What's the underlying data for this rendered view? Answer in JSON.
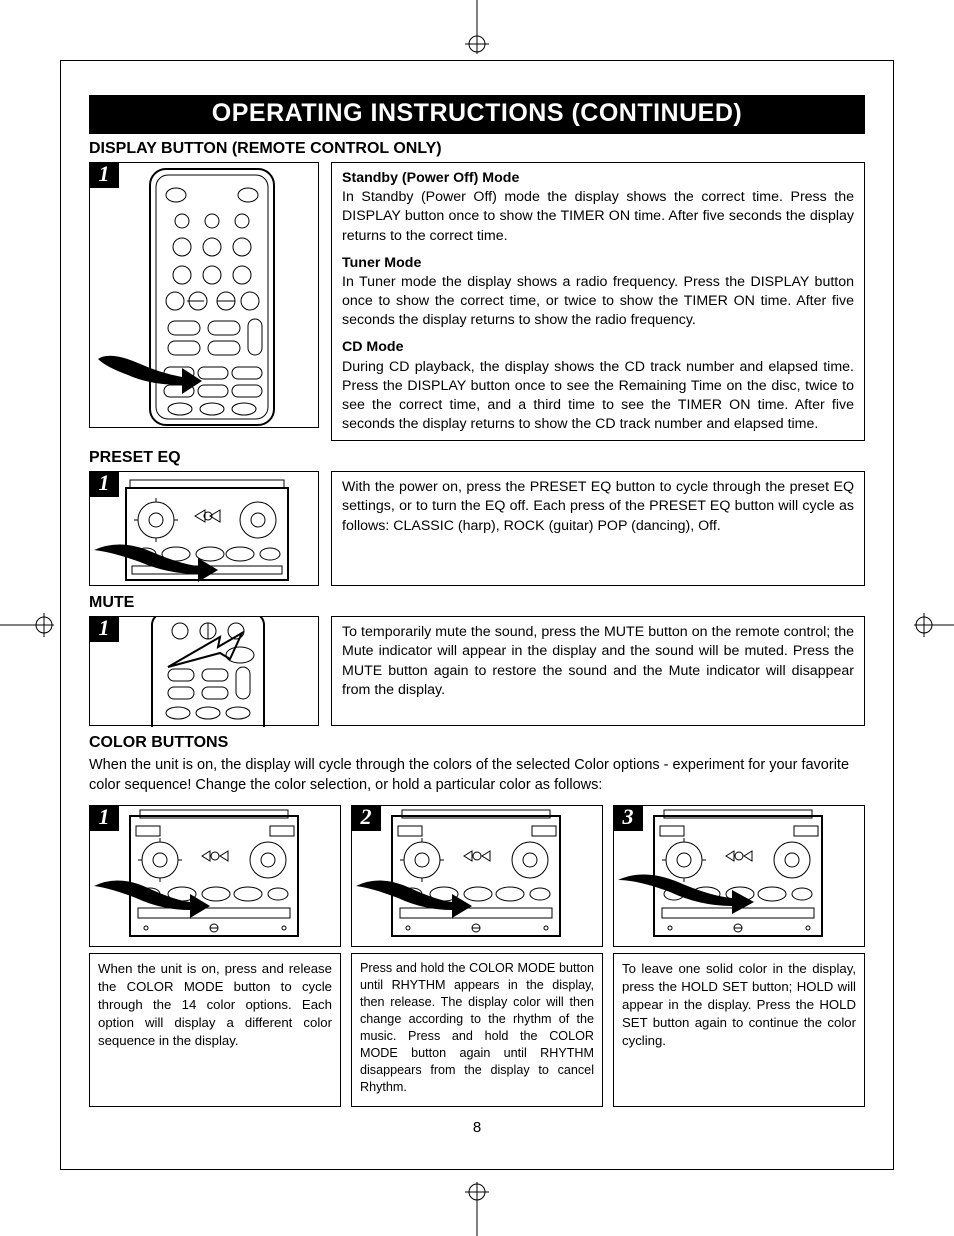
{
  "title": "OPERATING INSTRUCTIONS (CONTINUED)",
  "page_number": "8",
  "sections": {
    "display": {
      "heading": "DISPLAY BUTTON (REMOTE CONTROL ONLY)",
      "step": "1",
      "modes": [
        {
          "title": "Standby (Power Off) Mode",
          "body": "In Standby (Power Off) mode the display shows the correct time. Press the DISPLAY button once to show the TIMER ON time. After five seconds the display returns to the correct time."
        },
        {
          "title": "Tuner Mode",
          "body": "In Tuner mode the display shows a radio frequency. Press the DISPLAY button once to show the correct time, or twice to show the TIMER ON time. After five seconds the display returns to show the radio frequency."
        },
        {
          "title": "CD Mode",
          "body": "During CD playback, the display shows the CD track number and elapsed time. Press the DISPLAY button once to see the Remaining Time on the disc, twice to see the correct time, and a third time to see the TIMER ON time. After five seconds the display returns to show the CD track number and elapsed time."
        }
      ]
    },
    "preset_eq": {
      "heading": "PRESET EQ",
      "step": "1",
      "body": "With the power on, press the PRESET EQ button to cycle through the preset EQ settings, or to turn the EQ off. Each press of the PRESET EQ button will cycle as follows: CLASSIC (harp), ROCK (guitar) POP (dancing), Off."
    },
    "mute": {
      "heading": "MUTE",
      "step": "1",
      "body": "To temporarily mute the sound, press the MUTE button on the remote control; the Mute indicator will appear in the display and the sound will be muted. Press the MUTE button again to restore the sound and the Mute indicator will disappear from the display."
    },
    "color": {
      "heading": "COLOR BUTTONS",
      "intro": "When the unit is on, the display will cycle through the colors of the selected Color options - experiment for your favorite color sequence! Change the color selection, or hold a particular color as follows:",
      "steps": [
        {
          "num": "1",
          "body": "When the unit is on, press and release the COLOR MODE button to cycle through the 14 color options. Each option will display a different color sequence in the display."
        },
        {
          "num": "2",
          "body": "Press and hold the COLOR MODE button until RHYTHM appears in the display, then release. The display color will then change according to the rhythm of the music. Press and hold the COLOR MODE button again until RHYTHM disappears from the display to cancel Rhythm."
        },
        {
          "num": "3",
          "body": "To leave one solid color in the display, press the HOLD SET button; HOLD will appear in the display. Press the HOLD SET button again to continue the color cycling."
        }
      ]
    }
  }
}
